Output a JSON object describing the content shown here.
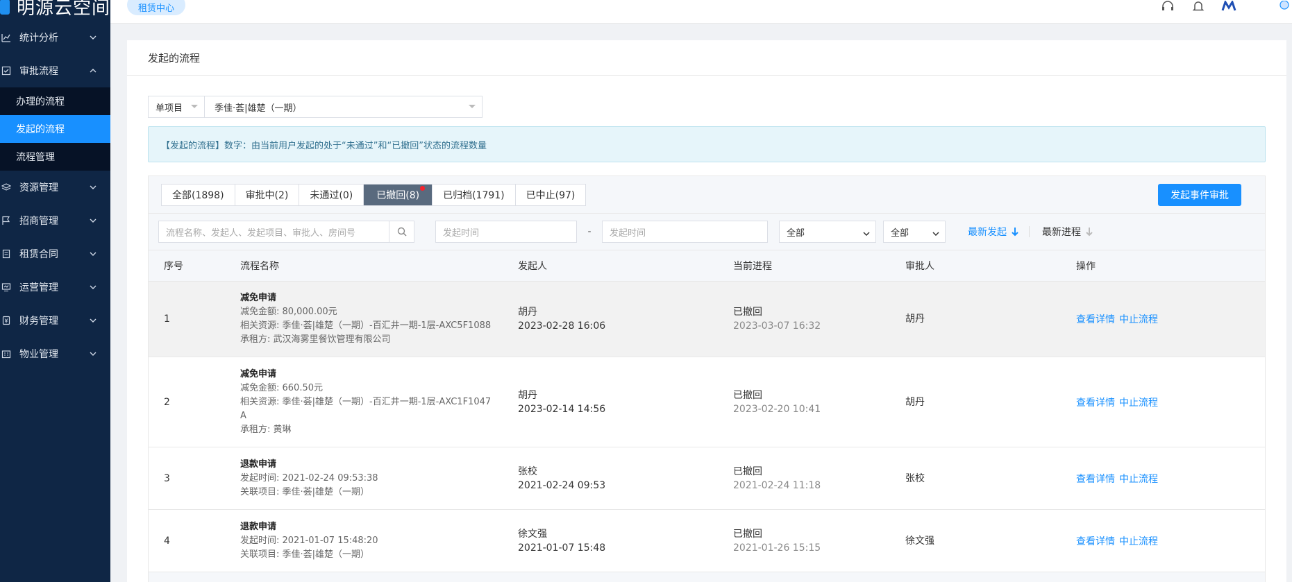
{
  "app": {
    "logo_text": "明源云空间",
    "tag": "租赁中心"
  },
  "sidebar": {
    "groups": [
      {
        "label": "统计分析",
        "icon": "chart-icon",
        "expanded": false
      },
      {
        "label": "审批流程",
        "icon": "approval-icon",
        "expanded": true,
        "items": [
          {
            "label": "办理的流程",
            "active": false
          },
          {
            "label": "发起的流程",
            "active": true
          },
          {
            "label": "流程管理",
            "active": false
          }
        ]
      },
      {
        "label": "资源管理",
        "icon": "layers-icon",
        "expanded": false
      },
      {
        "label": "招商管理",
        "icon": "flag-icon",
        "expanded": false
      },
      {
        "label": "租赁合同",
        "icon": "contract-icon",
        "expanded": false
      },
      {
        "label": "运营管理",
        "icon": "monitor-icon",
        "expanded": false
      },
      {
        "label": "财务管理",
        "icon": "finance-icon",
        "expanded": false
      },
      {
        "label": "物业管理",
        "icon": "building-icon",
        "expanded": false
      }
    ]
  },
  "page": {
    "title": "发起的流程",
    "scope_select": "单项目",
    "project_select": "季佳·荟|雄楚（一期）",
    "info": "【发起的流程】数字：由当前用户发起的处于“未通过”和“已撤回”状态的流程数量"
  },
  "tabs": [
    {
      "label": "全部(1898)",
      "active": false,
      "dot": false
    },
    {
      "label": "审批中(2)",
      "active": false,
      "dot": false
    },
    {
      "label": "未通过(0)",
      "active": false,
      "dot": false
    },
    {
      "label": "已撤回(8)",
      "active": true,
      "dot": true
    },
    {
      "label": "已归档(1791)",
      "active": false,
      "dot": false
    },
    {
      "label": "已中止(97)",
      "active": false,
      "dot": false
    }
  ],
  "actions": {
    "start_button": "发起事件审批"
  },
  "search": {
    "keyword_placeholder": "流程名称、发起人、发起项目、审批人、房间号",
    "start_time_placeholder": "发起时间",
    "dash": "-",
    "end_time_placeholder": "发起时间",
    "filter1": "全部",
    "filter2": "全部",
    "sort_latest_start": "最新发起",
    "sort_latest_progress": "最新进程"
  },
  "table": {
    "headers": [
      "序号",
      "流程名称",
      "发起人",
      "当前进程",
      "审批人",
      "操作"
    ],
    "rows": [
      {
        "no": "1",
        "name": "减免申请",
        "details": [
          "减免金额: 80,000.00元",
          "相关资源: 季佳·荟|雄楚（一期）-百汇井一期-1层-AXC5F1088",
          "承租方: 武汉海雾里餐饮管理有限公司"
        ],
        "initiator": "胡丹",
        "initiated_at": "2023-02-28 16:06",
        "status": "已撤回",
        "status_at": "2023-03-07 16:32",
        "approver": "胡丹",
        "highlight": true
      },
      {
        "no": "2",
        "name": "减免申请",
        "details": [
          "减免金额: 660.50元",
          "相关资源: 季佳·荟|雄楚（一期）-百汇井一期-1层-AXC1F1047",
          "A",
          "承租方: 黄琳"
        ],
        "initiator": "胡丹",
        "initiated_at": "2023-02-14 14:56",
        "status": "已撤回",
        "status_at": "2023-02-20 10:41",
        "approver": "胡丹",
        "highlight": false
      },
      {
        "no": "3",
        "name": "退款申请",
        "details": [
          "发起时间: 2021-02-24 09:53:38",
          "关联项目: 季佳·荟|雄楚（一期）"
        ],
        "initiator": "张校",
        "initiated_at": "2021-02-24 09:53",
        "status": "已撤回",
        "status_at": "2021-02-24 11:18",
        "approver": "张校",
        "highlight": false
      },
      {
        "no": "4",
        "name": "退款申请",
        "details": [
          "发起时间: 2021-01-07 15:48:20",
          "关联项目: 季佳·荟|雄楚（一期）"
        ],
        "initiator": "徐文强",
        "initiated_at": "2021-01-07 15:48",
        "status": "已撤回",
        "status_at": "2021-01-26 15:15",
        "approver": "徐文强",
        "highlight": false
      }
    ],
    "op_view": "查看详情",
    "op_stop": "中止流程"
  },
  "colors": {
    "sidebar_bg": "#0f2645",
    "accent": "#1890ff",
    "active_tab": "#596a7e"
  }
}
